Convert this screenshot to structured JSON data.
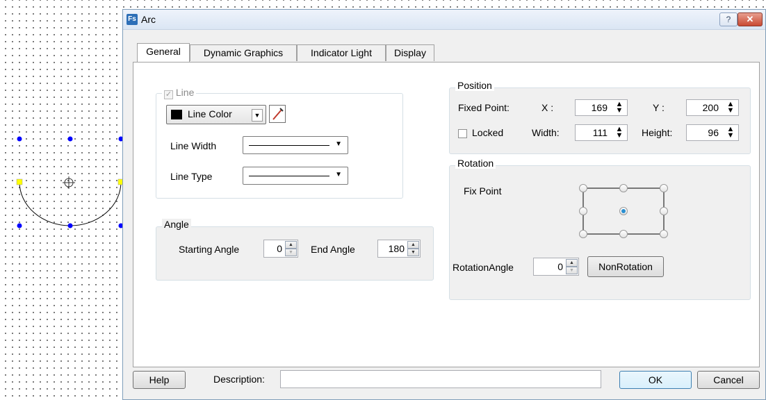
{
  "dialog": {
    "icon_text": "Fs",
    "title": "Arc",
    "help_symbol": "?",
    "close_symbol": "✕"
  },
  "tabs": [
    {
      "label": "General",
      "active": true
    },
    {
      "label": "Dynamic Graphics",
      "active": false
    },
    {
      "label": "Indicator Light",
      "active": false
    },
    {
      "label": "Display",
      "active": false
    }
  ],
  "line_group": {
    "title": "Line",
    "checked": true,
    "enabled": false,
    "color_button_label": "Line Color",
    "color_value": "#000000",
    "line_width_label": "Line Width",
    "line_type_label": "Line Type"
  },
  "angle_group": {
    "title": "Angle",
    "starting_angle_label": "Starting Angle",
    "starting_angle_value": "0",
    "end_angle_label": "End Angle",
    "end_angle_value": "180"
  },
  "position_group": {
    "title": "Position",
    "fixed_point_label": "Fixed Point:",
    "x_label": "X :",
    "x_value": "169",
    "y_label": "Y :",
    "y_value": "200",
    "locked_label": "Locked",
    "locked_checked": false,
    "width_label": "Width:",
    "width_value": "111",
    "height_label": "Height:",
    "height_value": "96"
  },
  "rotation_group": {
    "title": "Rotation",
    "fix_point_label": "Fix Point",
    "selected_fix_point": "center",
    "rotation_angle_label": "RotationAngle",
    "rotation_angle_value": "0",
    "non_rotation_label": "NonRotation"
  },
  "footer": {
    "help_label": "Help",
    "description_label": "Description:",
    "description_value": "",
    "ok_label": "OK",
    "cancel_label": "Cancel"
  },
  "colors": {
    "handle_blue": "#0000ff",
    "handle_yellow": "#ffff00",
    "radio_selected": "#2a8fd1"
  }
}
